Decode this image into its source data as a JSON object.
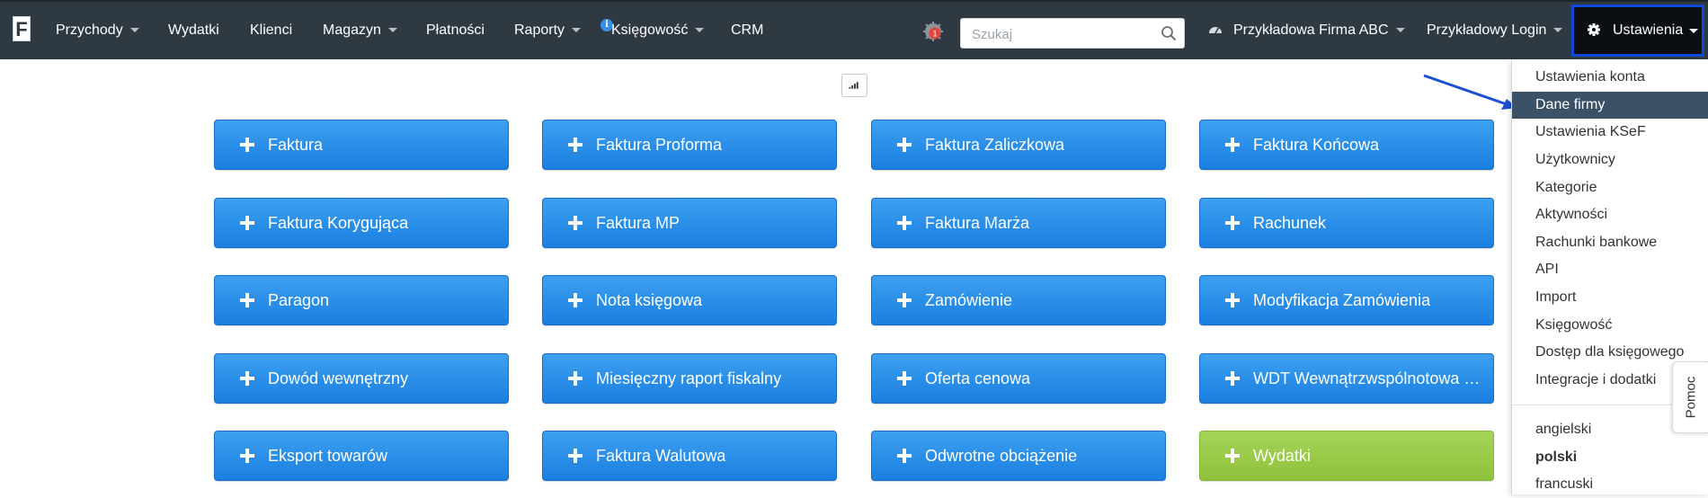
{
  "navbar": {
    "logo_letter": "F",
    "items": [
      {
        "label": "Przychody",
        "dropdown": true
      },
      {
        "label": "Wydatki",
        "dropdown": false
      },
      {
        "label": "Klienci",
        "dropdown": false
      },
      {
        "label": "Magazyn",
        "dropdown": true
      },
      {
        "label": "Płatności",
        "dropdown": false
      },
      {
        "label": "Raporty",
        "dropdown": true
      },
      {
        "label": "Księgowość",
        "dropdown": true
      },
      {
        "label": "CRM",
        "dropdown": false
      }
    ],
    "info_badge": "i",
    "notification_count": "1",
    "search": {
      "placeholder": "Szukaj"
    },
    "company": "Przykładowa Firma ABC",
    "login": "Przykładowy Login",
    "settings": "Ustawienia"
  },
  "tiles": [
    {
      "label": "Faktura",
      "color": "#1e88e5"
    },
    {
      "label": "Faktura Proforma",
      "color": "#1e88e5"
    },
    {
      "label": "Faktura Zaliczkowa",
      "color": "#1e88e5"
    },
    {
      "label": "Faktura Końcowa",
      "color": "#1e88e5"
    },
    {
      "label": "Faktura Korygująca",
      "color": "#1e88e5"
    },
    {
      "label": "Faktura MP",
      "color": "#1e88e5"
    },
    {
      "label": "Faktura Marża",
      "color": "#1e88e5"
    },
    {
      "label": "Rachunek",
      "color": "#1e88e5"
    },
    {
      "label": "Paragon",
      "color": "#1e88e5"
    },
    {
      "label": "Nota księgowa",
      "color": "#1e88e5"
    },
    {
      "label": "Zamówienie",
      "color": "#1e88e5"
    },
    {
      "label": "Modyfikacja Zamówienia",
      "color": "#1e88e5"
    },
    {
      "label": "Dowód wewnętrzny",
      "color": "#1e88e5"
    },
    {
      "label": "Miesięczny raport fiskalny",
      "color": "#1e88e5"
    },
    {
      "label": "Oferta cenowa",
      "color": "#1e88e5"
    },
    {
      "label": "WDT Wewnątrzwspólnotowa …",
      "color": "#1e88e5"
    },
    {
      "label": "Eksport towarów",
      "color": "#1e88e5"
    },
    {
      "label": "Faktura Walutowa",
      "color": "#1e88e5"
    },
    {
      "label": "Odwrotne obciążenie",
      "color": "#1e88e5"
    },
    {
      "label": "Wydatki",
      "color": "#9ccc4f"
    }
  ],
  "settings_menu": {
    "items": [
      {
        "label": "Ustawienia konta"
      },
      {
        "label": "Dane firmy",
        "active": true
      },
      {
        "label": "Ustawienia KSeF"
      },
      {
        "label": "Użytkownicy"
      },
      {
        "label": "Kategorie"
      },
      {
        "label": "Aktywności"
      },
      {
        "label": "Rachunki bankowe"
      },
      {
        "label": "API"
      },
      {
        "label": "Import"
      },
      {
        "label": "Księgowość"
      },
      {
        "label": "Dostęp dla księgowego"
      },
      {
        "label": "Integracje i dodatki"
      }
    ],
    "languages": [
      {
        "label": "angielski"
      },
      {
        "label": "polski",
        "active": true
      },
      {
        "label": "francuski"
      }
    ]
  },
  "help_tab": "Pomoc",
  "colors": {
    "navbar_bg": "#2f3942",
    "tile_blue": "#1e88e5",
    "tile_green": "#9ccc4f",
    "menu_active": "#3b5168",
    "highlight_border": "#1048d8"
  }
}
